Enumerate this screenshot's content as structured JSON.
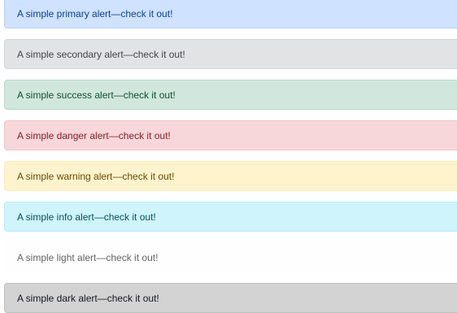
{
  "alerts": [
    {
      "variant": "primary",
      "text": "A simple primary alert—check it out!",
      "background": "#cfe2ff",
      "color": "#084298"
    },
    {
      "variant": "secondary",
      "text": "A simple secondary alert—check it out!",
      "background": "#e2e3e5",
      "color": "#41464b"
    },
    {
      "variant": "success",
      "text": "A simple success alert—check it out!",
      "background": "#d1e7dd",
      "color": "#0f5132"
    },
    {
      "variant": "danger",
      "text": "A simple danger alert—check it out!",
      "background": "#f8d7da",
      "color": "#842029"
    },
    {
      "variant": "warning",
      "text": "A simple warning alert—check it out!",
      "background": "#fff3cd",
      "color": "#664d03"
    },
    {
      "variant": "info",
      "text": "A simple info alert—check it out!",
      "background": "#cff4fc",
      "color": "#055160"
    },
    {
      "variant": "light",
      "text": "A simple light alert—check it out!",
      "background": "#fefefe",
      "color": "#636464"
    },
    {
      "variant": "dark",
      "text": "A simple dark alert—check it out!",
      "background": "#d3d3d4",
      "color": "#141619"
    }
  ]
}
